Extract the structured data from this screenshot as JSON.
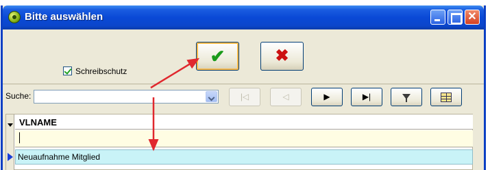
{
  "window": {
    "title": "Bitte auswählen"
  },
  "options": {
    "readonly_label": "Schreibschutz",
    "readonly_checked": true
  },
  "actions": {
    "ok_glyph": "✔",
    "cancel_glyph": "✖"
  },
  "search": {
    "label": "Suche:",
    "value": ""
  },
  "navigation": {
    "buttons": [
      {
        "icon": "first-record-icon",
        "glyph": "|◁",
        "enabled": false
      },
      {
        "icon": "previous-record-icon",
        "glyph": "◁",
        "enabled": false
      },
      {
        "icon": "next-record-icon",
        "glyph": "▶",
        "enabled": true
      },
      {
        "icon": "last-record-icon",
        "glyph": "▶|",
        "enabled": true
      },
      {
        "icon": "filter-icon",
        "glyph": "",
        "enabled": true
      },
      {
        "icon": "grid-options-icon",
        "glyph": "",
        "enabled": true
      }
    ]
  },
  "grid": {
    "columns": [
      "VLNAME"
    ],
    "filter_value": "",
    "rows": [
      {
        "VLNAME": "Neuaufnahme Mitglied",
        "selected": true
      }
    ]
  },
  "colors": {
    "titlebar": "#0a49d6",
    "filter_row": "#fffde3",
    "selected_row": "#c9f3f7",
    "annotation_arrow": "#e0282e"
  }
}
